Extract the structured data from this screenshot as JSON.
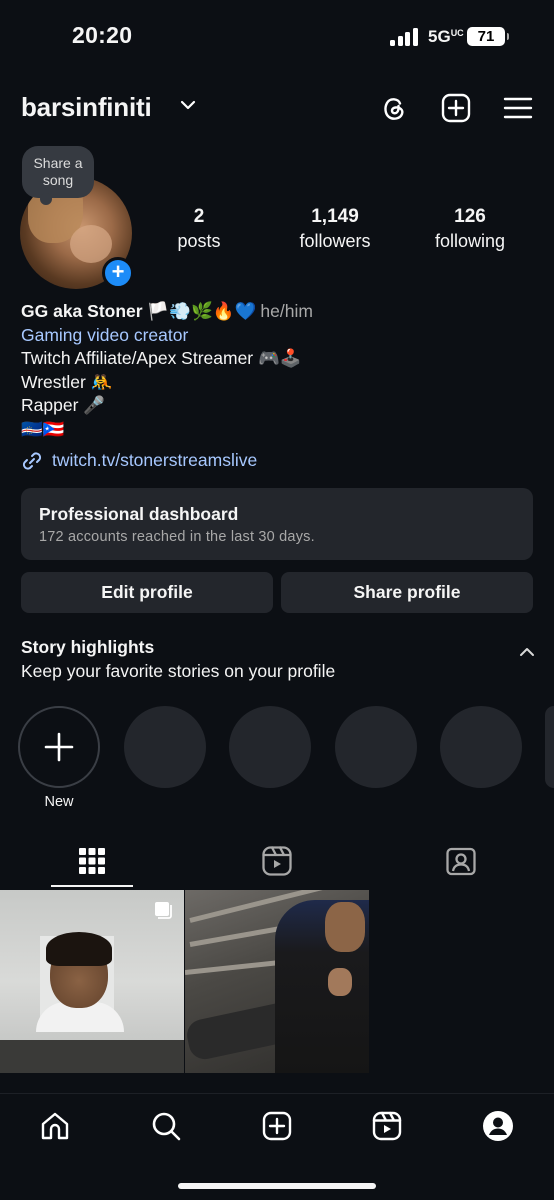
{
  "status_bar": {
    "time": "20:20",
    "network": "5G",
    "network_suffix": "UC",
    "battery": "71"
  },
  "header": {
    "username": "barsinfiniti",
    "icons": [
      "threads-icon",
      "create-icon",
      "menu-icon"
    ]
  },
  "profile": {
    "share_song_label": "Share a song",
    "stats": [
      {
        "value": "2",
        "label": "posts"
      },
      {
        "value": "1,149",
        "label": "followers"
      },
      {
        "value": "126",
        "label": "following"
      }
    ],
    "bio": {
      "name": "GG aka Stoner 🏳️💨🌿🔥💙",
      "pronouns": "he/him",
      "category": "Gaming video creator",
      "lines": [
        "Twitch Affiliate/Apex Streamer 🎮🕹️",
        "Wrestler 🤼",
        "Rapper 🎤",
        "🇨🇻🇵🇷"
      ],
      "link": "twitch.tv/stonerstreamslive"
    }
  },
  "dashboard": {
    "title": "Professional dashboard",
    "subtitle": "172 accounts reached in the last 30 days."
  },
  "actions": {
    "edit_label": "Edit profile",
    "share_label": "Share profile"
  },
  "highlights": {
    "title": "Story highlights",
    "subtitle": "Keep your favorite stories on your profile",
    "new_label": "New"
  },
  "tabs": [
    "grid-icon",
    "reels-icon",
    "tagged-icon"
  ],
  "bottom_nav": [
    "home-icon",
    "search-icon",
    "create-icon",
    "reels-icon",
    "profile-icon"
  ],
  "colors": {
    "background": "#0c0f14",
    "surface": "#23262c",
    "link": "#a7c8ff",
    "accent": "#1d8cf8"
  }
}
